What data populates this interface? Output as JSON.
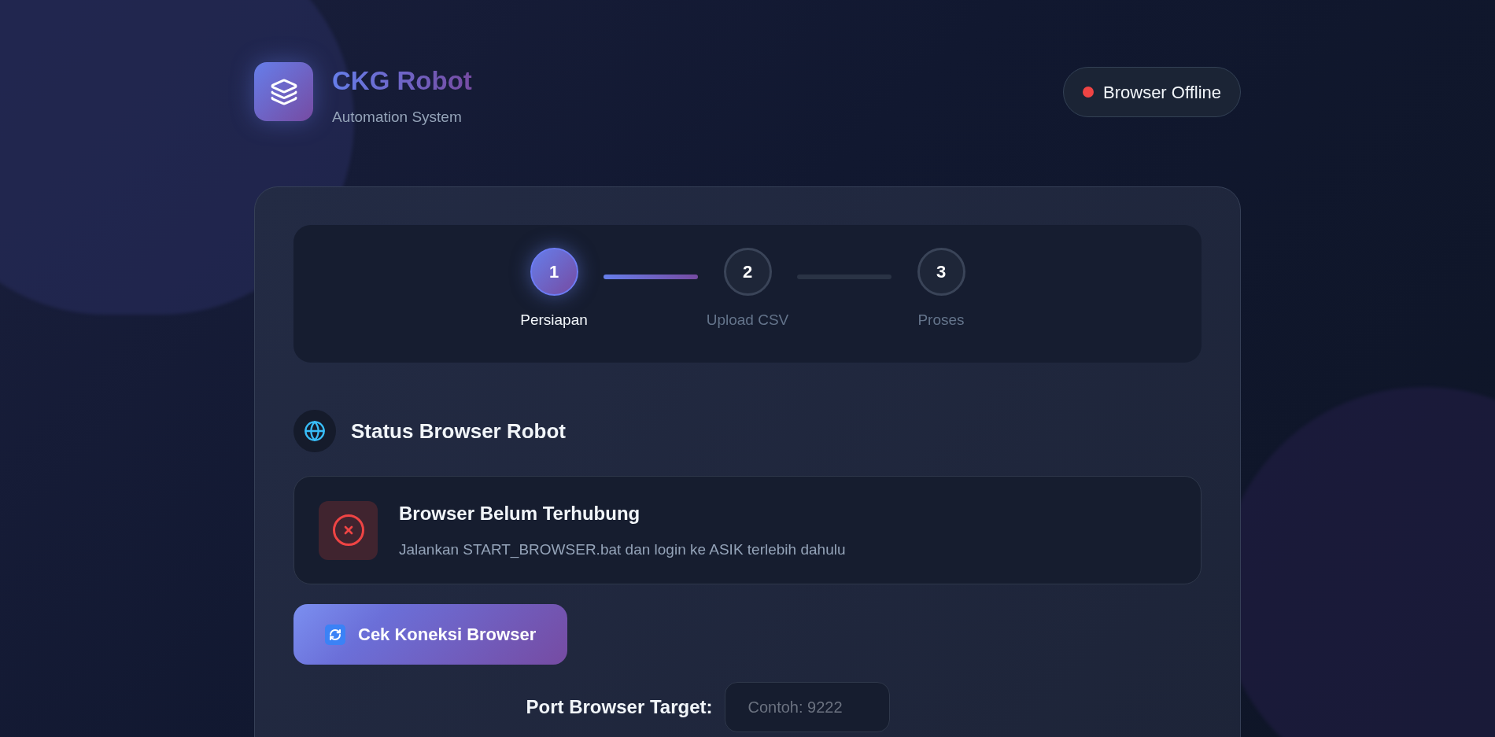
{
  "header": {
    "title": "CKG Robot",
    "subtitle": "Automation System"
  },
  "connection_badge": {
    "label": "Browser Offline",
    "online": false
  },
  "steps": [
    {
      "number": "1",
      "label": "Persiapan",
      "selected": true
    },
    {
      "number": "2",
      "label": "Upload CSV",
      "selected": false
    },
    {
      "number": "3",
      "label": "Proses",
      "selected": false
    }
  ],
  "section": {
    "title": "Status Browser Robot"
  },
  "status_card": {
    "title": "Browser Belum Terhubung",
    "description": "Jalankan START_BROWSER.bat dan login ke ASIK terlebih dahulu",
    "connected": false
  },
  "check_button": {
    "label": "Cek Koneksi Browser"
  },
  "port_field": {
    "label": "Port Browser Target:",
    "placeholder": "Contoh: 9222"
  }
}
